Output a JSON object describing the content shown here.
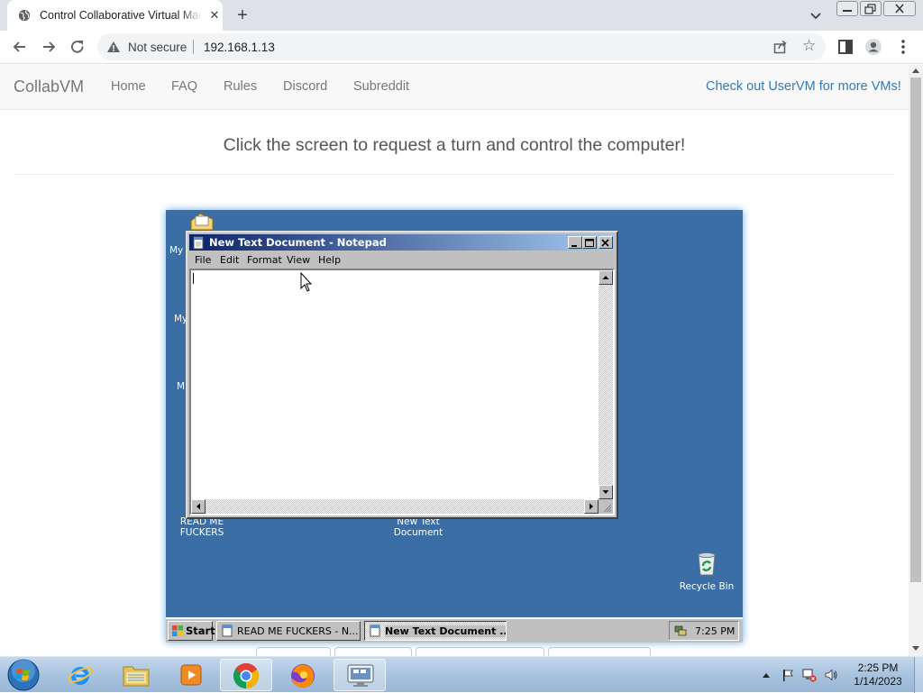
{
  "browser": {
    "tab_title": "Control Collaborative Virtual Machines",
    "tab_close": "✕",
    "new_tab": "+",
    "security_label": "Not secure",
    "url": "192.168.1.13"
  },
  "site": {
    "brand": "CollabVM",
    "nav": [
      "Home",
      "FAQ",
      "Rules",
      "Discord",
      "Subreddit"
    ],
    "nav_right": "Check out UserVM for more VMs!",
    "headline": "Click the screen to request a turn and control the computer!"
  },
  "vm": {
    "desktop_icons": {
      "partial_1": "My",
      "partial_2": "My",
      "partial_3": "M",
      "read_me": [
        "READ ME",
        "FUCKERS"
      ],
      "new_text": [
        "New Text",
        "Document"
      ],
      "recycle": "Recycle Bin"
    },
    "notepad": {
      "title": "New Text Document - Notepad",
      "menu": [
        "File",
        "Edit",
        "Format",
        "View",
        "Help"
      ]
    },
    "taskbar": {
      "start": "Start",
      "tasks": [
        "READ ME FUCKERS - N...",
        "New Text Document ..."
      ],
      "time": "7:25 PM"
    }
  },
  "win7": {
    "time": "2:25 PM",
    "date": "1/14/2023"
  },
  "colors": {
    "vm_desktop": "#3a6ea5",
    "link": "#337ab7",
    "titlebar_start": "#0a246a",
    "titlebar_end": "#a6caf0"
  }
}
